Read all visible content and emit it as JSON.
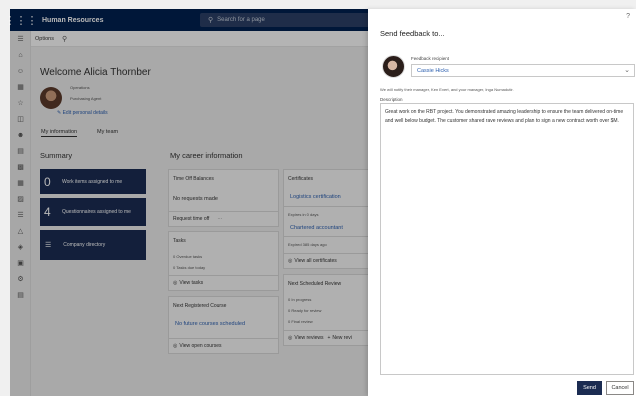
{
  "topbar": {
    "app_title": "Human Resources",
    "search_placeholder": "Search for a page"
  },
  "optbar": {
    "options_label": "Options"
  },
  "profile": {
    "welcome": "Welcome Alicia Thornber",
    "department": "Operations",
    "job_title": "Purchasing Agent",
    "edit_link": "Edit personal details"
  },
  "tabs": [
    {
      "label": "My information"
    },
    {
      "label": "My team"
    }
  ],
  "summary": {
    "heading": "Summary",
    "tiles": [
      {
        "count": "0",
        "label": "Work items assigned to me"
      },
      {
        "count": "4",
        "label": "Questionnaires assigned to me"
      },
      {
        "label": "Company directory"
      }
    ]
  },
  "career": {
    "heading": "My career information",
    "time_off": {
      "title": "Time Off Balances",
      "status": "No requests made",
      "action": "Request time off",
      "more": "···"
    },
    "tasks": {
      "title": "Tasks",
      "overdue": "0 Overdue tasks",
      "due_today": "0 Tasks due today",
      "action": "View tasks"
    },
    "course": {
      "title": "Next Registered Course",
      "empty": "No future courses scheduled",
      "action": "View open courses"
    },
    "certificates": {
      "title": "Certificates",
      "cert1": "Logistics certification",
      "cert1_status": "Expires in 0 days",
      "cert2": "Chartered accountant",
      "cert2_status": "Expired 385 days ago",
      "action": "View all certificates"
    },
    "review": {
      "title": "Next Scheduled Review",
      "in_progress": "0 In progress",
      "ready": "0 Ready for review",
      "final": "0 Final review",
      "action": "View reviews",
      "action2": "New revi"
    }
  },
  "panel": {
    "help": "?",
    "title": "Send feedback to...",
    "recipient_label": "Feedback recipient",
    "recipient": "Cassie Hicks",
    "notify": "We will notify their manager, Ken Evert, and your manager, Inga Numadutir.",
    "description_label": "Description",
    "description": "Great work on the RBT project.  You demonstrated amazing leadership to ensure the team delivered on-time and well below budget. The customer shared rave reviews and plan to sign a new contract worth over $M.",
    "send_label": "Send",
    "cancel_label": "Cancel"
  },
  "colors": {
    "nav": "#002050",
    "tile": "#1b2c52",
    "link": "#2b5eae"
  }
}
